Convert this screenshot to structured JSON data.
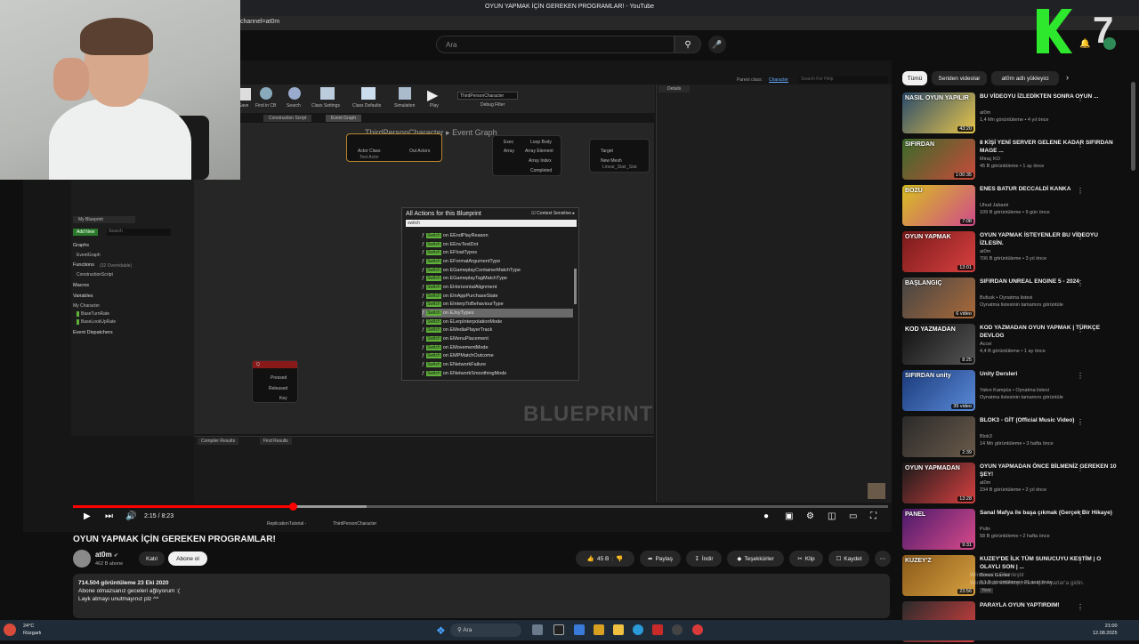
{
  "browser": {
    "tab_title": "OYUN YAPMAK İÇİN GEREKEN PROGRAMLAR! - YouTube",
    "url_fragment": "channel=at0m"
  },
  "youtube": {
    "search_placeholder": "Ara"
  },
  "unreal": {
    "toolbar": [
      {
        "label": "Save"
      },
      {
        "label": "Find in CB"
      },
      {
        "label": "Search"
      },
      {
        "label": "Class Settings"
      },
      {
        "label": "Class Defaults"
      },
      {
        "label": "Simulation"
      },
      {
        "label": "Play"
      }
    ],
    "debug_object": "ThirdPersonCharacter",
    "debug_filter": "Debug Filter",
    "tabs": [
      "Construction Script",
      "Event Graph"
    ],
    "breadcrumb_class": "ThirdPersonCharacter",
    "breadcrumb_graph": "Event Graph",
    "details_tab": "Details",
    "parent_class_label": "Parent class:",
    "parent_class": "Character",
    "search_help": "Search For Help",
    "my_blueprint": "My Blueprint",
    "add_new": "Add New",
    "search": "Search",
    "sections": {
      "graphs": "Graphs",
      "event_graph": "EventGraph",
      "functions": "Functions",
      "functions_count": "(32 Overridable)",
      "construction_script": "ConstructionScript",
      "macros": "Macros",
      "variables": "Variables",
      "my_character": "My Character",
      "var1": "BaseTurnRate",
      "var2": "BaseLookUpRate",
      "event_dispatchers": "Event Dispatchers"
    },
    "nodes": {
      "actor_class": "Actor Class",
      "out_actors": "Out Actors",
      "test_actor": "Test Actor",
      "exec": "Exec",
      "loop_body": "Loop Body",
      "array": "Array",
      "array_element": "Array Element",
      "array_index": "Array Index",
      "completed": "Completed",
      "target": "Target",
      "new_mesh": "New Mesh",
      "mesh_value": "Linear_Stair_Stat",
      "key_node_title": "Q",
      "pressed": "Pressed",
      "released": "Released",
      "key": "Key"
    },
    "actions_popup": {
      "title": "All Actions for this Blueprint",
      "context": "Context Sensitive",
      "filter": "switch",
      "switch_word": "Switch",
      "items": [
        "on EEndPlayReason",
        "on EEnvTestDot",
        "on EFloatTypes",
        "on EFormatArgumentType",
        "on EGameplayContainerMatchType",
        "on EGameplayTagMatchType",
        "on EHorizontalAlignment",
        "on EInAppPurchaseState",
        "on EInterpToBehaviourType",
        "on EJoyTypes",
        "on ELerpInterpolationMode",
        "on EMediaPlayerTrack",
        "on EMenuPlacement",
        "on EMovementMode",
        "on EMPMatchOutcome",
        "on ENetworkFailure",
        "on ENetworkSmoothingMode"
      ],
      "selected_index": 9
    },
    "watermark": "BLUEPRINT",
    "bottom_tabs": [
      "Compiler Results",
      "Find Results"
    ],
    "taskbar_items": [
      "ReplicationTutorial -",
      "ThirdPersonCharacter"
    ]
  },
  "player": {
    "time": "2:15 / 8:23",
    "progress_played": 0.27,
    "progress_buffered": 0.36
  },
  "video": {
    "title": "OYUN YAPMAK İÇİN GEREKEN PROGRAMLAR!",
    "channel": "at0m",
    "subscribers": "462 B abone",
    "join": "Katıl",
    "subscribe": "Abone ol",
    "likes": "45 B",
    "share": "Paylaş",
    "download": "İndir",
    "thanks": "Teşekkürler",
    "clip": "Klip",
    "save": "Kaydet",
    "views_line": "714.504 görüntüleme  23 Eki 2020",
    "desc_line1": "Abone olmazsanız geceleri ağlıyorum :(",
    "desc_line2": "Layk atmayı unutmayınız plz ^^"
  },
  "sidebar": {
    "chips": [
      "Tümü",
      "Seriden videolar",
      "at0m adlı yükleyici"
    ],
    "items": [
      {
        "title": "BU VİDEOYU İZLEDİKTEN SONRA OYUN ...",
        "channel": "at0m",
        "meta": "1,4 Mn görüntüleme • 4 yıl önce",
        "duration": "43:20",
        "overlay": "NASIL OYUN YAPILIR",
        "c1": "#2a4b6b",
        "c2": "#e8c54a"
      },
      {
        "title": "8 KİŞİ YENİ SERVER GELENE KADAR SIFIRDAN MAGE ...",
        "channel": "Miraç KO",
        "meta": "45 B görüntüleme • 1 ay önce",
        "duration": "1:00:35",
        "overlay": "SIFIRDAN",
        "c1": "#3a6b2a",
        "c2": "#c84a3a"
      },
      {
        "title": "ENES BATUR DECCALDİ KANKA",
        "channel": "Uhud Jabami",
        "meta": "109 B görüntüleme • 9 gün önce",
        "duration": "7:08",
        "overlay": "BOZU",
        "c1": "#d8c020",
        "c2": "#d04a8a"
      },
      {
        "title": "OYUN YAPMAK İSTEYENLER BU VİDEOYU İZLESİN.",
        "channel": "at0m",
        "meta": "706 B görüntüleme • 3 yıl önce",
        "duration": "13:01",
        "overlay": "OYUN YAPMAK",
        "c1": "#7a1a1a",
        "c2": "#d84040"
      },
      {
        "title": "SIFIRDAN UNREAL ENGINE 5 - 2024",
        "channel": "Bufusk • Oynatma listesi",
        "meta": "Oynatma listesinin tamamını görüntüle",
        "duration": "6 video",
        "overlay": "BAŞLANGIÇ",
        "c1": "#444444",
        "c2": "#aa6a3a"
      },
      {
        "title": "KOD YAZMADAN OYUN YAPMAK | TÜRKÇE DEVLOG",
        "channel": "Accei",
        "meta": "4,4 B görüntüleme • 1 ay önce",
        "duration": "8:25",
        "overlay": "KOD YAZMADAN",
        "c1": "#111111",
        "c2": "#555555"
      },
      {
        "title": "Unity Dersleri",
        "channel": "Yakın Kampüs • Oynatma listesi",
        "meta": "Oynatma listesinin tamamını görüntüle",
        "duration": "39 video",
        "overlay": "SIFIRDAN unity",
        "c1": "#1a3a7a",
        "c2": "#5a8ad8"
      },
      {
        "title": "BLOK3 - GİT (Official Music Video)",
        "channel": "Blok3",
        "meta": "14 Mn görüntüleme • 3 hafta önce",
        "duration": "2:39",
        "overlay": "",
        "c1": "#2a2a2a",
        "c2": "#6a5a4a"
      },
      {
        "title": "OYUN YAPMADAN ÖNCE BİLMENİZ GEREKEN 10 ŞEY!",
        "channel": "at0m",
        "meta": "234 B görüntüleme • 2 yıl önce",
        "duration": "13:28",
        "overlay": "OYUN YAPMADAN",
        "c1": "#1a1a1a",
        "c2": "#d84040"
      },
      {
        "title": "Sanal Mafya ile başa çıkmak (Gerçek Bir Hikaye)",
        "channel": "Pulix",
        "meta": "58 B görüntüleme • 2 hafta önce",
        "duration": "9:31",
        "overlay": "PANEL",
        "c1": "#4a1a6a",
        "c2": "#d84a8a"
      },
      {
        "title": "KUZEY'DE İLK TÜM SUNUCUYU KESTİM | O OLAYLI SON | ...",
        "channel": "Bonus Gamer",
        "meta": "9,1 B görüntüleme • 21 saat önce",
        "duration": "23:56",
        "overlay": "KUZEY'Z",
        "c1": "#8a5a1a",
        "c2": "#d8a040"
      },
      {
        "title": "PARAYLA OYUN YAPTIRDIM!",
        "channel": "",
        "meta": "",
        "duration": "",
        "overlay": "",
        "c1": "#2a2a2a",
        "c2": "#d84040"
      }
    ],
    "badge_new": "Yeni"
  },
  "windows_watermark": {
    "line1": "Windows'u Etkinleştir",
    "line2": "Windows'u etkinleştirmek için Ayarlar'a gidin."
  },
  "taskbar": {
    "weather_temp": "24°C",
    "weather_desc": "Rüzgarlı",
    "search_placeholder": "Ara",
    "time": "21:00",
    "date": "12.08.2025"
  }
}
